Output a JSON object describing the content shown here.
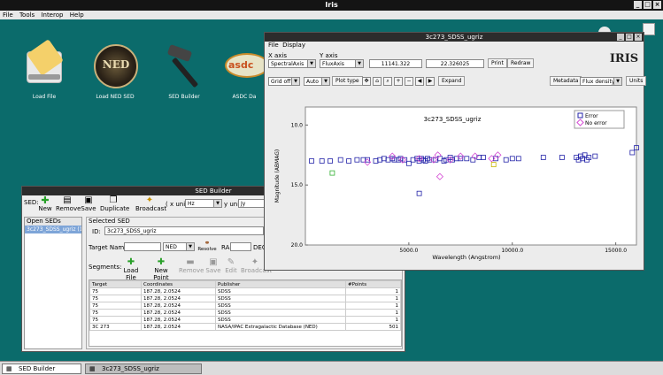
{
  "app": {
    "title": "Iris"
  },
  "menu": [
    "File",
    "Tools",
    "Interop",
    "Help"
  ],
  "desktop_icons": [
    {
      "label": "Load File",
      "icon": "load-file-icon"
    },
    {
      "label": "Load NED SED",
      "icon": "ned-icon"
    },
    {
      "label": "SED Builder",
      "icon": "hammer-icon"
    },
    {
      "label": "ASDC Da",
      "icon": "asdc-icon"
    }
  ],
  "sed_builder": {
    "title": "SED Builder",
    "sed_label": "SED:",
    "toolbar": [
      "New",
      "Remove",
      "Save",
      "Duplicate",
      "Broadcast"
    ],
    "x_unit_label": "( x unit",
    "x_unit_value": "Hz",
    "y_unit_label": "y unit",
    "y_unit_value": "Jy",
    "open_seds_label": "Open SEDs",
    "open_seds": [
      "3c273_SDSS_ugriz (1"
    ],
    "selected_sed_label": "Selected SED",
    "id_label": "ID:",
    "id_value": "3c273_SDSS_ugriz",
    "target_name_label": "Target Name",
    "target_value": "",
    "ned_value": "NED",
    "resolve_label": "Resolve",
    "ra_label": "RA",
    "dec_label": "DEC",
    "segments_label": "Segments:",
    "segment_buttons": [
      "Load File",
      "New Point",
      "Remove",
      "Save",
      "Edit",
      "Broadcast"
    ],
    "columns": [
      "Target",
      "Coordinates",
      "Publisher",
      "#Points"
    ],
    "rows": [
      [
        "75",
        "187.28, 2.0524",
        "SDSS",
        "1"
      ],
      [
        "75",
        "187.28, 2.0524",
        "SDSS",
        "1"
      ],
      [
        "75",
        "187.28, 2.0524",
        "SDSS",
        "1"
      ],
      [
        "75",
        "187.28, 2.0524",
        "SDSS",
        "1"
      ],
      [
        "75",
        "187.28, 2.0524",
        "SDSS",
        "1"
      ],
      [
        "3C 273",
        "187.28, 2.0524",
        "NASA/IPAC Extragalactic Database (NED)",
        "501"
      ]
    ]
  },
  "plot_window": {
    "title": "3c273_SDSS_ugriz",
    "menu": [
      "File",
      "Display"
    ],
    "x_axis_label": "X axis",
    "x_axis_value": "SpectralAxis",
    "y_axis_label": "Y axis",
    "y_axis_value": "FluxAxis",
    "coord_x": "11141.322",
    "coord_y": "22.326025",
    "print_label": "Print",
    "redraw_label": "Redraw",
    "logo_text": "IRIS",
    "grid_value": "Grid off",
    "auto_value": "Auto",
    "plot_type_label": "Plot type",
    "expand_label": "Expand",
    "metadata_label": "Metadata",
    "flux_density_value": "Flux density",
    "units_label": "Units",
    "colors": {
      "error": "#2323a8",
      "no_error": "#d44ad4",
      "green": "#33b033",
      "yellow": "#c8b400"
    }
  },
  "chart_data": {
    "type": "scatter",
    "title": "3c273_SDSS_ugriz",
    "xlabel": "Wavelength (Angstrom)",
    "ylabel": "Magnitude (ABMAG)",
    "xlim": [
      0,
      16000
    ],
    "ylim": [
      20.0,
      8.5
    ],
    "y_inverted": true,
    "x_ticks": [
      "5000.0",
      "10000.0",
      "15000.0"
    ],
    "y_ticks": [
      "10.0",
      "15.0",
      "20.0"
    ],
    "legend": [
      "Error",
      "No error"
    ],
    "legend_position": "top-right",
    "series": [
      {
        "name": "Error",
        "color": "#2323a8",
        "points": [
          [
            300,
            13.0
          ],
          [
            800,
            13.0
          ],
          [
            1200,
            13.0
          ],
          [
            1700,
            12.9
          ],
          [
            2100,
            13.0
          ],
          [
            2500,
            12.9
          ],
          [
            2800,
            12.9
          ],
          [
            3000,
            12.9
          ],
          [
            3400,
            13.0
          ],
          [
            3600,
            12.9
          ],
          [
            3800,
            12.8
          ],
          [
            4000,
            12.9
          ],
          [
            4200,
            12.8
          ],
          [
            4300,
            12.9
          ],
          [
            4500,
            12.9
          ],
          [
            4600,
            12.8
          ],
          [
            4800,
            12.9
          ],
          [
            5000,
            13.2
          ],
          [
            5200,
            12.9
          ],
          [
            5400,
            12.8
          ],
          [
            5500,
            13.0
          ],
          [
            5600,
            12.8
          ],
          [
            5700,
            12.9
          ],
          [
            5800,
            13.0
          ],
          [
            5900,
            12.8
          ],
          [
            6000,
            12.9
          ],
          [
            6300,
            12.9
          ],
          [
            6500,
            12.8
          ],
          [
            6700,
            13.0
          ],
          [
            6800,
            12.9
          ],
          [
            7000,
            12.7
          ],
          [
            7100,
            12.9
          ],
          [
            7300,
            12.8
          ],
          [
            7500,
            12.8
          ],
          [
            7800,
            12.8
          ],
          [
            8100,
            12.9
          ],
          [
            8400,
            12.7
          ],
          [
            8600,
            12.7
          ],
          [
            9200,
            12.8
          ],
          [
            9700,
            12.9
          ],
          [
            10000,
            12.8
          ],
          [
            10300,
            12.8
          ],
          [
            11500,
            12.7
          ],
          [
            12400,
            12.7
          ],
          [
            13100,
            12.7
          ],
          [
            13200,
            12.9
          ],
          [
            13300,
            12.6
          ],
          [
            13400,
            12.8
          ],
          [
            13500,
            12.5
          ],
          [
            13600,
            12.9
          ],
          [
            13700,
            12.7
          ],
          [
            14000,
            12.6
          ],
          [
            15800,
            12.3
          ],
          [
            16000,
            11.9
          ],
          [
            5500,
            15.7
          ]
        ]
      },
      {
        "name": "No error",
        "color": "#d44ad4",
        "points": [
          [
            3000,
            13.1
          ],
          [
            4200,
            12.6
          ],
          [
            4700,
            12.9
          ],
          [
            5500,
            12.8
          ],
          [
            6200,
            12.9
          ],
          [
            6400,
            12.5
          ],
          [
            6500,
            14.3
          ],
          [
            7000,
            12.9
          ],
          [
            7500,
            12.6
          ],
          [
            8200,
            12.6
          ],
          [
            9000,
            12.8
          ],
          [
            9300,
            12.5
          ]
        ]
      },
      {
        "name": "",
        "color": "#33b033",
        "points": [
          [
            1300,
            14.0
          ]
        ]
      },
      {
        "name": "",
        "color": "#c8b400",
        "points": [
          [
            9100,
            13.3
          ]
        ]
      }
    ]
  }
}
